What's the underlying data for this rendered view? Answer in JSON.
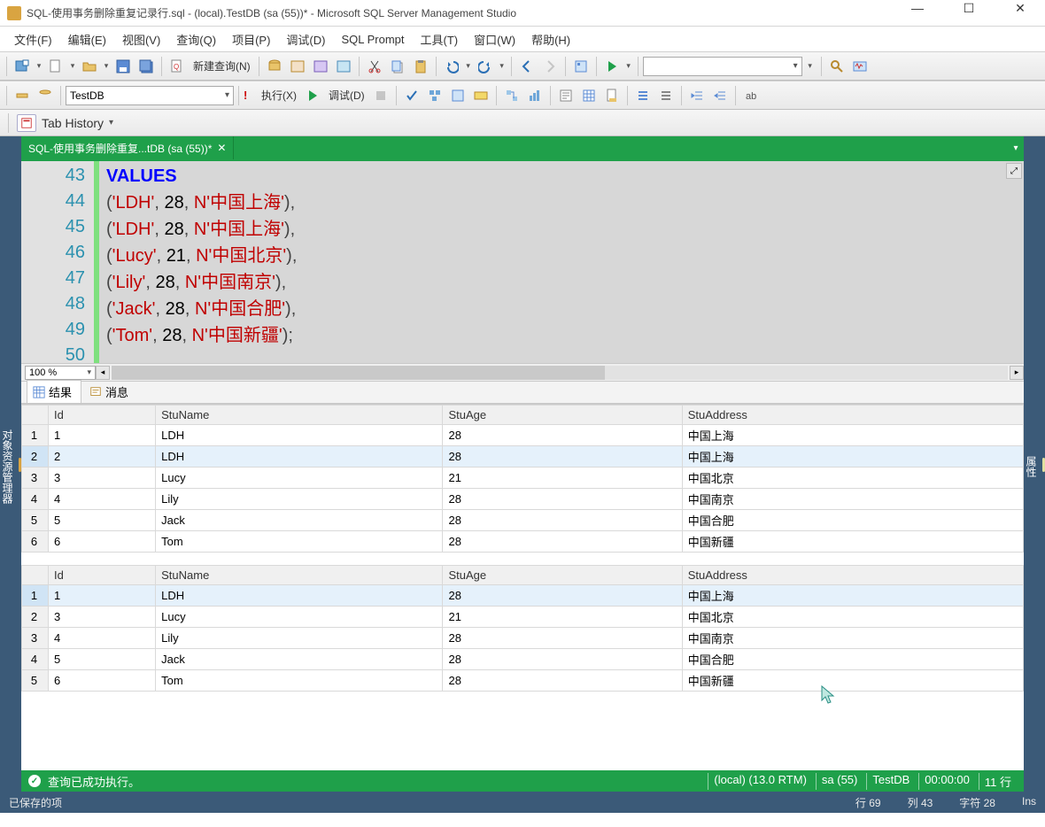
{
  "title": "SQL-使用事务删除重复记录行.sql - (local).TestDB (sa (55))* - Microsoft SQL Server Management Studio",
  "menu": [
    "文件(F)",
    "编辑(E)",
    "视图(V)",
    "查询(Q)",
    "项目(P)",
    "调试(D)",
    "SQL Prompt",
    "工具(T)",
    "窗口(W)",
    "帮助(H)"
  ],
  "toolbar1": {
    "newquery": "新建查询(N)"
  },
  "toolbar2": {
    "dbcombo": "TestDB",
    "execute": "执行(X)",
    "debug": "调试(D)"
  },
  "tabhistory": "Tab History",
  "docTab": "SQL-使用事务删除重复...tDB (sa (55))*",
  "leftPanel": "对象资源管理器",
  "rightPanel": "属性",
  "gutter": [
    "43",
    "44",
    "45",
    "46",
    "47",
    "48",
    "49",
    "50"
  ],
  "keyword_values": "VALUES",
  "rows_code": [
    {
      "name": "'LDH'",
      "age": "28",
      "addr": "N'中国上海'",
      "end": "),"
    },
    {
      "name": "'LDH'",
      "age": "28",
      "addr": "N'中国上海'",
      "end": "),"
    },
    {
      "name": "'Lucy'",
      "age": "21",
      "addr": "N'中国北京'",
      "end": "),"
    },
    {
      "name": "'Lily'",
      "age": "28",
      "addr": "N'中国南京'",
      "end": "),"
    },
    {
      "name": "'Jack'",
      "age": "28",
      "addr": "N'中国合肥'",
      "end": "),"
    },
    {
      "name": "'Tom'",
      "age": "28",
      "addr": "N'中国新疆'",
      "end": ");"
    }
  ],
  "zoom": "100 %",
  "resTabs": {
    "results": "结果",
    "messages": "消息"
  },
  "cols": [
    "",
    "Id",
    "StuName",
    "StuAge",
    "StuAddress"
  ],
  "grid1": [
    {
      "n": "1",
      "id": "1",
      "name": "LDH",
      "age": "28",
      "addr": "中国上海",
      "sel": false
    },
    {
      "n": "2",
      "id": "2",
      "name": "LDH",
      "age": "28",
      "addr": "中国上海",
      "sel": true
    },
    {
      "n": "3",
      "id": "3",
      "name": "Lucy",
      "age": "21",
      "addr": "中国北京",
      "sel": false
    },
    {
      "n": "4",
      "id": "4",
      "name": "Lily",
      "age": "28",
      "addr": "中国南京",
      "sel": false
    },
    {
      "n": "5",
      "id": "5",
      "name": "Jack",
      "age": "28",
      "addr": "中国合肥",
      "sel": false
    },
    {
      "n": "6",
      "id": "6",
      "name": "Tom",
      "age": "28",
      "addr": "中国新疆",
      "sel": false
    }
  ],
  "grid2": [
    {
      "n": "1",
      "id": "1",
      "name": "LDH",
      "age": "28",
      "addr": "中国上海",
      "sel": true
    },
    {
      "n": "2",
      "id": "3",
      "name": "Lucy",
      "age": "21",
      "addr": "中国北京",
      "sel": false
    },
    {
      "n": "3",
      "id": "4",
      "name": "Lily",
      "age": "28",
      "addr": "中国南京",
      "sel": false
    },
    {
      "n": "4",
      "id": "5",
      "name": "Jack",
      "age": "28",
      "addr": "中国合肥",
      "sel": false
    },
    {
      "n": "5",
      "id": "6",
      "name": "Tom",
      "age": "28",
      "addr": "中国新疆",
      "sel": false
    }
  ],
  "queryStatus": {
    "msg": "查询已成功执行。",
    "server": "(local) (13.0 RTM)",
    "user": "sa (55)",
    "db": "TestDB",
    "time": "00:00:00",
    "rows": "11 行"
  },
  "statusbar": {
    "saved": "已保存的项",
    "row": "行 69",
    "col": "列 43",
    "char": "字符 28",
    "ins": "Ins"
  }
}
